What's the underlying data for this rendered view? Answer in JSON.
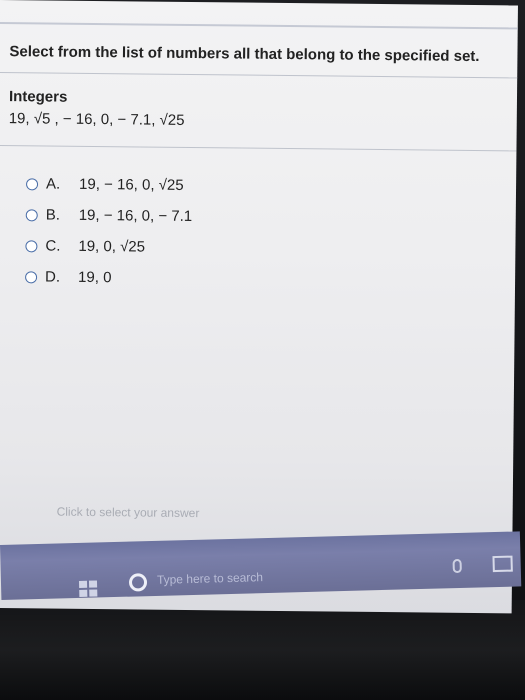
{
  "question": {
    "prompt": "Select from the list of numbers all that belong to the specified set.",
    "set_name": "Integers",
    "numbers": "19, √5 , − 16, 0, − 7.1, √25"
  },
  "options": [
    {
      "letter": "A.",
      "text": "19, − 16, 0, √25"
    },
    {
      "letter": "B.",
      "text": "19, − 16, 0, − 7.1"
    },
    {
      "letter": "C.",
      "text": "19, 0, √25"
    },
    {
      "letter": "D.",
      "text": "19, 0"
    }
  ],
  "hint": "Click to select your answer",
  "taskbar": {
    "search_placeholder": "Type here to search",
    "start_icon": "windows-logo-icon",
    "cortana_icon": "cortana-circle-icon",
    "mic_icon": "microphone-icon",
    "task_view_icon": "task-view-icon"
  },
  "colors": {
    "radio_border": "#4a6ea8",
    "taskbar": "#6c73a0"
  }
}
